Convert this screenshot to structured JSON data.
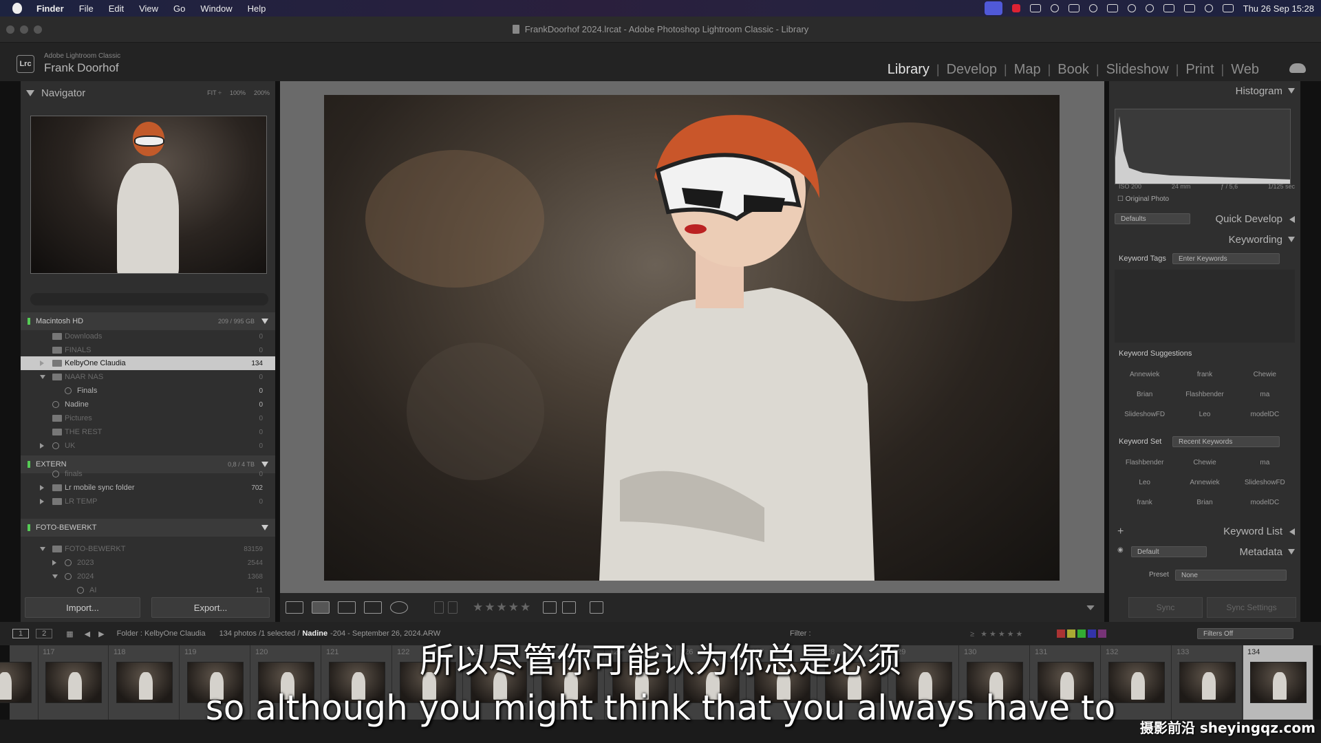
{
  "menubar": {
    "app": "Finder",
    "items": [
      "File",
      "Edit",
      "View",
      "Go",
      "Window",
      "Help"
    ],
    "datetime": "Thu 26 Sep  15:28"
  },
  "window": {
    "title": "FrankDoorhof 2024.lrcat - Adobe Photoshop Lightroom Classic - Library"
  },
  "lr": {
    "app_name": "Adobe Lightroom Classic",
    "logo": "Lrc",
    "user": "Frank Doorhof",
    "modules": [
      "Library",
      "Develop",
      "Map",
      "Book",
      "Slideshow",
      "Print",
      "Web"
    ],
    "active_module": "Library"
  },
  "navigator": {
    "title": "Navigator",
    "zoom": [
      "FIT ÷",
      "100%",
      "200%"
    ]
  },
  "folders": {
    "volumes": [
      {
        "name": "Macintosh HD",
        "space": "209 / 995 GB"
      },
      {
        "name": "EXTERN",
        "space": "0,8 / 4 TB"
      },
      {
        "name": "FOTO-BEWERKT",
        "space": ""
      }
    ],
    "rows": [
      {
        "name": "Downloads",
        "count": "0",
        "state": "dim",
        "indent": 1,
        "exp": ""
      },
      {
        "name": "FINALS",
        "count": "0",
        "state": "dim",
        "indent": 1,
        "exp": ""
      },
      {
        "name": "KelbyOne Claudia",
        "count": "134",
        "state": "sel",
        "indent": 1,
        "exp": "right"
      },
      {
        "name": "NAAR NAS",
        "count": "0",
        "state": "dim",
        "indent": 1,
        "exp": "down"
      },
      {
        "name": "Finals",
        "count": "0",
        "state": "norm",
        "indent": 2,
        "exp": ""
      },
      {
        "name": "Nadine",
        "count": "0",
        "state": "norm",
        "indent": 1,
        "exp": ""
      },
      {
        "name": "Pictures",
        "count": "0",
        "state": "dim",
        "indent": 1,
        "exp": ""
      },
      {
        "name": "THE REST",
        "count": "0",
        "state": "dim",
        "indent": 1,
        "exp": ""
      },
      {
        "name": "UK",
        "count": "0",
        "state": "dim",
        "indent": 1,
        "exp": "right"
      },
      {
        "name": "finals",
        "count": "0",
        "state": "dim",
        "indent": 1,
        "exp": ""
      },
      {
        "name": "Lr mobile sync folder",
        "count": "702",
        "state": "norm",
        "indent": 1,
        "exp": "right"
      },
      {
        "name": "LR TEMP",
        "count": "0",
        "state": "dim",
        "indent": 1,
        "exp": "right"
      },
      {
        "name": "FOTO-BEWERKT",
        "count": "83159",
        "state": "dim",
        "indent": 1,
        "exp": "down"
      },
      {
        "name": "2023",
        "count": "2544",
        "state": "dim",
        "indent": 2,
        "exp": "right"
      },
      {
        "name": "2024",
        "count": "1368",
        "state": "dim",
        "indent": 2,
        "exp": "down"
      },
      {
        "name": "AI",
        "count": "11",
        "state": "dim",
        "indent": 3,
        "exp": ""
      }
    ],
    "import_label": "Import...",
    "export_label": "Export..."
  },
  "histogram": {
    "title": "Histogram",
    "iso": "ISO 200",
    "focal": "24 mm",
    "aperture": "ƒ / 5,6",
    "shutter": "1/125 sec",
    "original_photo": "Original Photo"
  },
  "quick_develop": {
    "title": "Quick Develop",
    "preset": "Defaults"
  },
  "keywording": {
    "title": "Keywording",
    "tags_label": "Keyword Tags",
    "tags_value": "Enter Keywords",
    "suggestions_label": "Keyword Suggestions",
    "suggestions": [
      "Annewiek",
      "frank",
      "Chewie",
      "Brian",
      "Flashbender",
      "ma",
      "SlideshowFD",
      "Leo",
      "modelDC"
    ],
    "set_label": "Keyword Set",
    "set_value": "Recent Keywords",
    "set_keywords": [
      "Flashbender",
      "Chewie",
      "ma",
      "Leo",
      "Annewiek",
      "SlideshowFD",
      "frank",
      "Brian",
      "modelDC"
    ]
  },
  "keyword_list": {
    "title": "Keyword List"
  },
  "metadata": {
    "title": "Metadata",
    "preset_select": "Default",
    "preset_label": "Preset",
    "preset_value": "None"
  },
  "sync": {
    "sync_label": "Sync",
    "sync_settings_label": "Sync Settings"
  },
  "filmstrip_bar": {
    "pages": [
      "1",
      "2"
    ],
    "folder": "Folder : KelbyOne Claudia",
    "count": "134 photos /1 selected /",
    "filename_bold": "Nadine",
    "filename_rest": "-204 - September 26, 2024.ARW",
    "filter_label": "Filter :",
    "filters_off": "Filters Off"
  },
  "filmstrip": {
    "numbers": [
      "117",
      "118",
      "119",
      "120",
      "121",
      "122",
      "123",
      "124",
      "125",
      "126",
      "127",
      "128",
      "129",
      "130",
      "131",
      "132",
      "133",
      "134"
    ],
    "selected": "134"
  },
  "subtitles": {
    "zh": "所以尽管你可能认为你总是必须",
    "en": "so although you might think that you always have to"
  },
  "watermark": "摄影前沿 sheyingqz.com",
  "colors": {
    "accent_sel": "#c9c9c9",
    "panel": "#2f2f2f",
    "tray_active": "#5059d8"
  }
}
